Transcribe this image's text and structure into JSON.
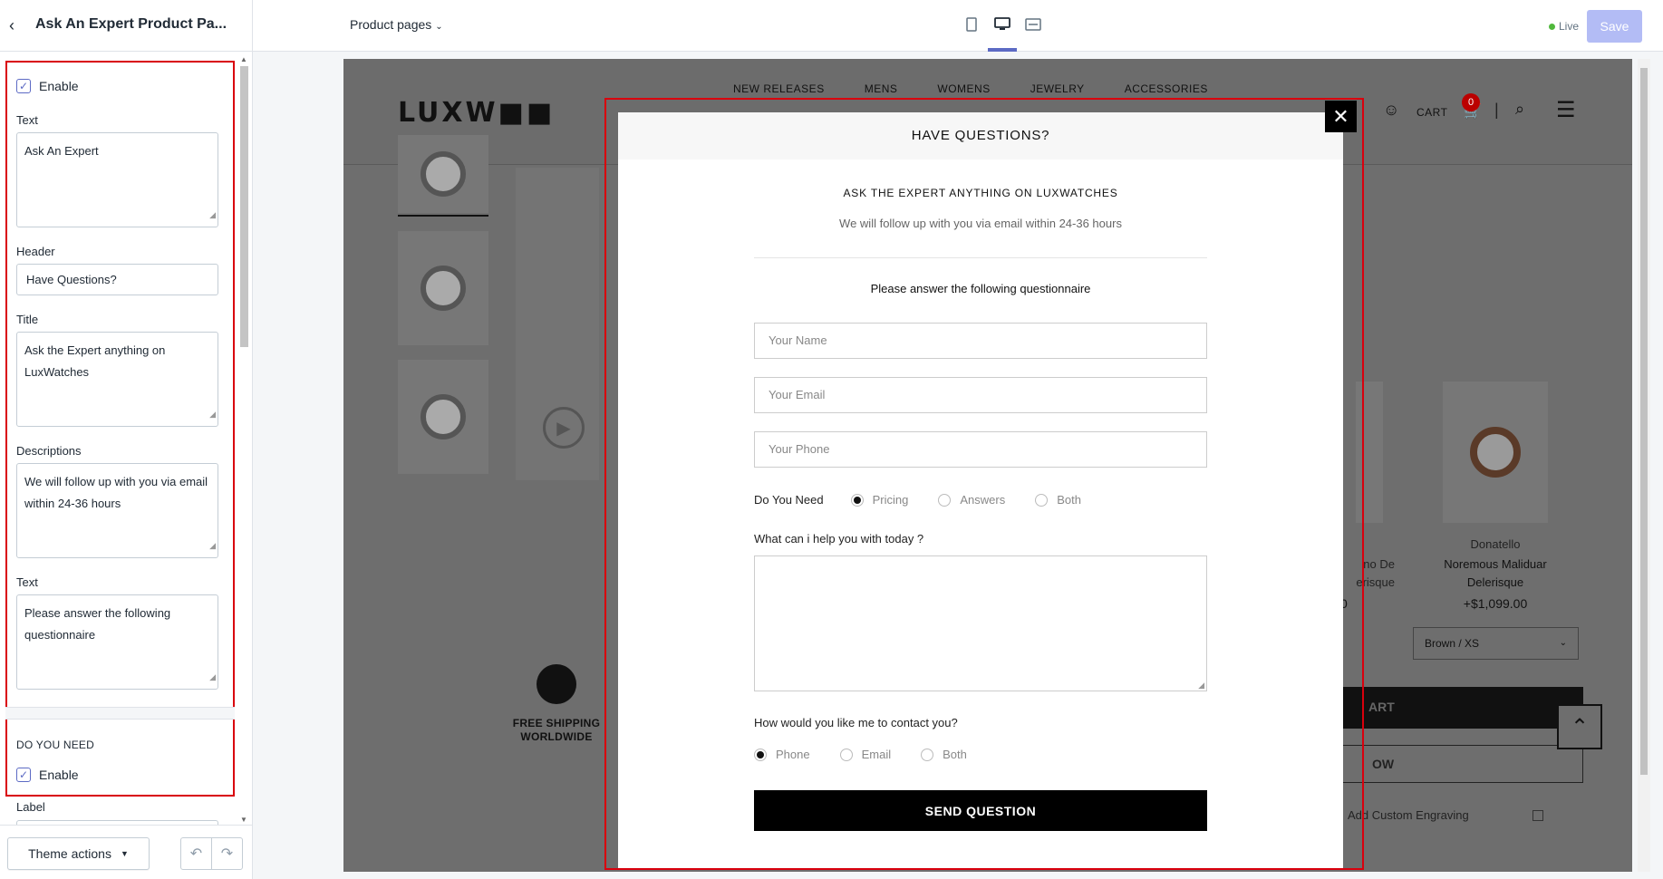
{
  "topbar": {
    "editor_title": "Ask An Expert Product Pa...",
    "page_select": "Product pages",
    "live_label": "Live",
    "save_label": "Save"
  },
  "sidebar": {
    "enable_label": "Enable",
    "text_label": "Text",
    "text_value": "Ask An Expert",
    "header_label": "Header",
    "header_value": "Have Questions?",
    "title_label": "Title",
    "title_value": "Ask the Expert anything on LuxWatches",
    "descriptions_label": "Descriptions",
    "descriptions_value": "We will follow up with you via email within 24-36 hours",
    "text2_label": "Text",
    "text2_value": "Please answer the following questionnaire",
    "section_heading": "DO YOU NEED",
    "enable2_label": "Enable",
    "label_label": "Label",
    "theme_actions": "Theme actions"
  },
  "store": {
    "logo": "LUXW■■",
    "nav": [
      "NEW RELEASES",
      "MENS",
      "WOMENS",
      "JEWELRY",
      "ACCESSORIES"
    ],
    "account_partial": "AC",
    "cart_label": "CART",
    "cart_count": "0",
    "shipping_line1": "FREE SHIPPING",
    "shipping_line2": "WORLDWIDE",
    "product_brand": "Donatello",
    "product_name": "Noremous Maliduar Delerisque",
    "product_price": "+$1,099.00",
    "partial_name": "no De erisque",
    "partial_price": "0",
    "variant": "Brown / XS",
    "add_cart_partial": "ART",
    "buy_now_partial": "OW",
    "engraving": "Add Custom Engraving"
  },
  "modal": {
    "header": "HAVE QUESTIONS?",
    "title": "ASK THE EXPERT ANYTHING ON LUXWATCHES",
    "description": "We will follow up with you via email within 24-36 hours",
    "question": "Please answer the following questionnaire",
    "name_placeholder": "Your Name",
    "email_placeholder": "Your Email",
    "phone_placeholder": "Your Phone",
    "need_label": "Do You Need",
    "need_options": [
      "Pricing",
      "Answers",
      "Both"
    ],
    "need_selected": "Pricing",
    "help_label": "What can i help you with today ?",
    "contact_label": "How would you like me to contact you?",
    "contact_options": [
      "Phone",
      "Email",
      "Both"
    ],
    "contact_selected": "Phone",
    "send_label": "SEND QUESTION"
  }
}
